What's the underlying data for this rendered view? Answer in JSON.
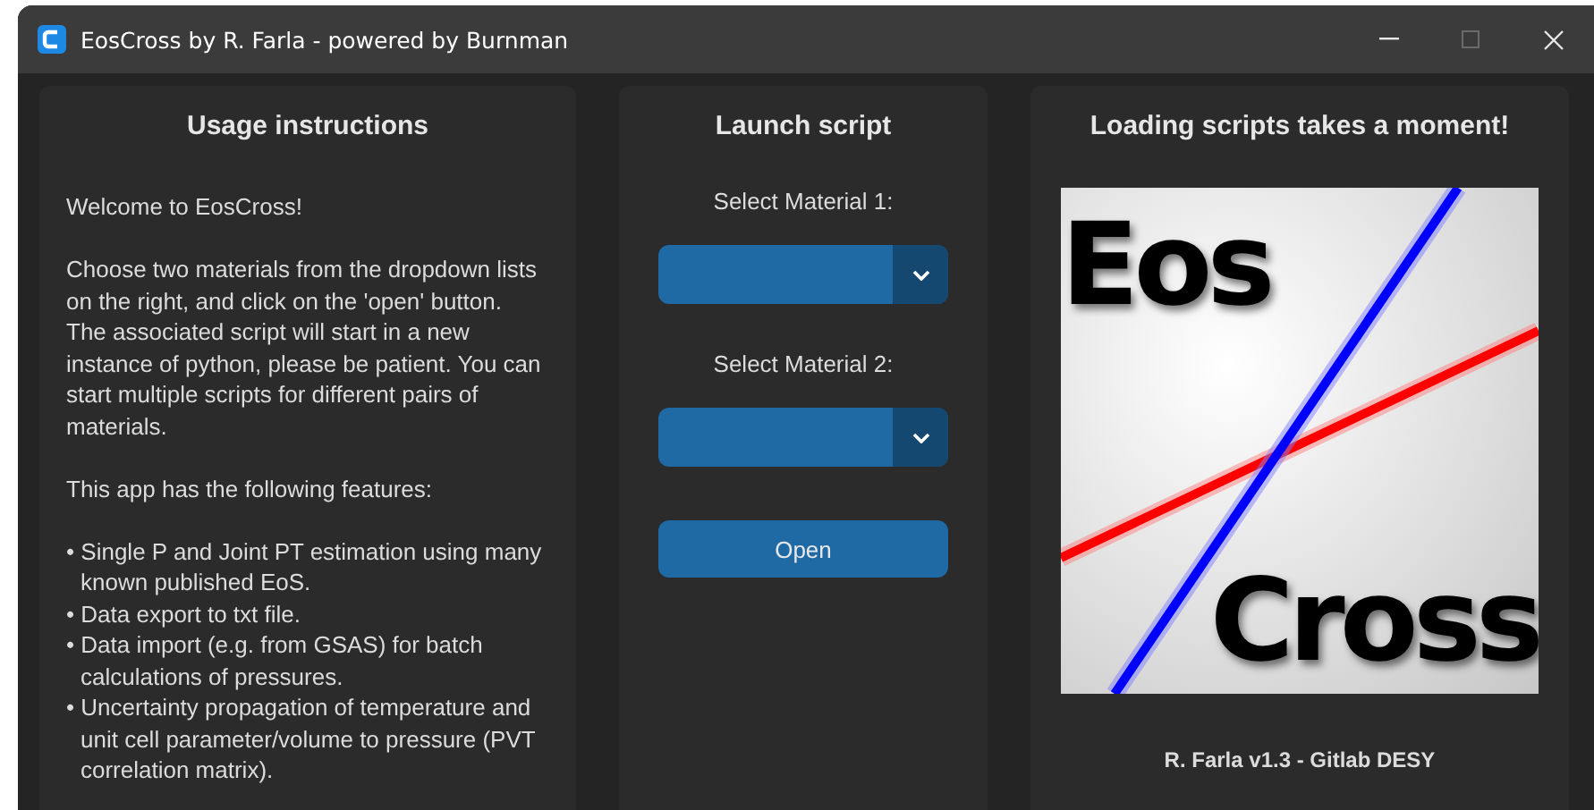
{
  "window": {
    "title": "EosCross by R. Farla - powered by Burnman",
    "controls": [
      {
        "kind": "minimize",
        "disabled": false
      },
      {
        "kind": "maximize",
        "disabled": true
      },
      {
        "kind": "close",
        "disabled": false
      }
    ]
  },
  "usage": {
    "title": "Usage instructions",
    "paragraphs": [
      "Welcome to EosCross!",
      "Choose two materials from the dropdown lists on the right, and click on the 'open' button. The associated script will start in a new instance of python, please be patient. You can start multiple scripts for different pairs of materials.",
      "This app has the following features:"
    ],
    "bullets": [
      "• Single P and Joint PT estimation using many known published EoS.",
      "• Data export to txt file.",
      "• Data import (e.g. from GSAS) for batch calculations of pressures.",
      "• Uncertainty propagation of temperature and unit cell parameter/volume to pressure (PVT correlation matrix)."
    ]
  },
  "launch": {
    "title": "Launch script",
    "selects": [
      {
        "label": "Select Material 1:"
      },
      {
        "label": "Select Material 2:"
      }
    ],
    "button": "Open"
  },
  "info": {
    "title": "Loading scripts takes a moment!",
    "logo": {
      "top": "Eos",
      "bottom": "Cross"
    },
    "footer": "R. Farla v1.3 - Gitlab DESY"
  }
}
